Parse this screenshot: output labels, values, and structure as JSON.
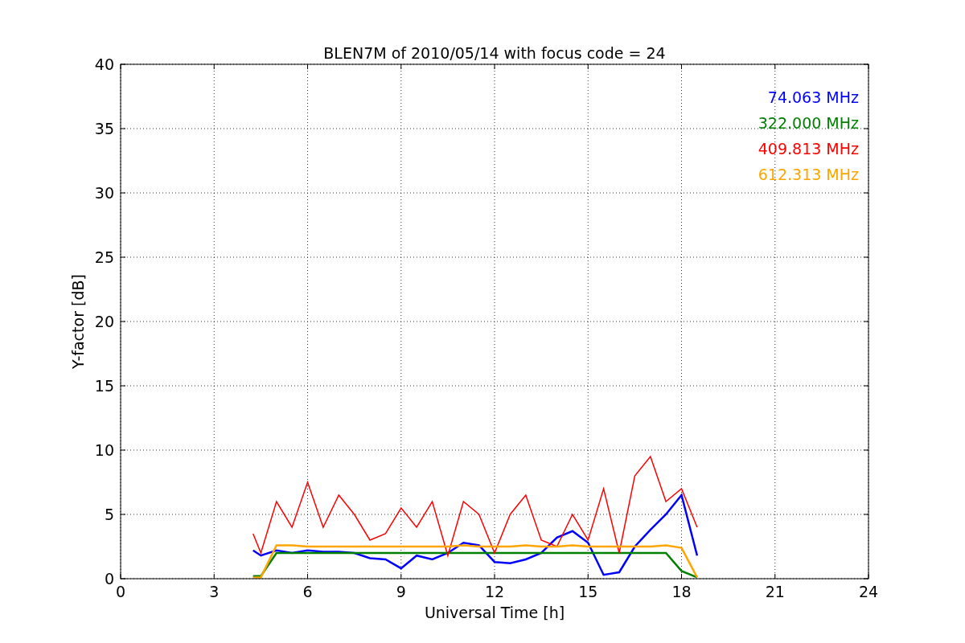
{
  "chart_data": {
    "type": "line",
    "title": "BLEN7M of 2010/05/14 with focus code = 24",
    "xlabel": "Universal Time [h]",
    "ylabel": "Y-factor [dB]",
    "x": [
      4.25,
      4.5,
      5,
      5.5,
      6,
      6.5,
      7,
      7.5,
      8,
      8.5,
      9,
      9.5,
      10,
      10.5,
      11,
      11.5,
      12,
      12.5,
      13,
      13.5,
      14,
      14.5,
      15,
      15.5,
      16,
      16.5,
      17,
      17.5,
      18,
      18.5
    ],
    "series": [
      {
        "name": "74.063 MHz",
        "color": "#0000ff",
        "values": [
          2.2,
          1.8,
          2.2,
          2.0,
          2.2,
          2.1,
          2.1,
          2.0,
          1.6,
          1.5,
          0.8,
          1.8,
          1.5,
          2.0,
          2.8,
          2.6,
          1.3,
          1.2,
          1.5,
          2.0,
          3.2,
          3.7,
          2.8,
          0.3,
          0.5,
          2.5,
          3.8,
          5.0,
          6.5,
          1.8
        ]
      },
      {
        "name": "322.000 MHz",
        "color": "#008000",
        "values": [
          0.2,
          0.2,
          2.0,
          2.0,
          2.0,
          2.0,
          2.0,
          2.0,
          2.0,
          2.0,
          2.0,
          2.0,
          2.0,
          2.0,
          2.0,
          2.0,
          2.0,
          2.0,
          2.0,
          2.0,
          2.0,
          2.0,
          2.0,
          2.0,
          2.0,
          2.0,
          2.0,
          2.0,
          0.6,
          0.1
        ]
      },
      {
        "name": "409.813 MHz",
        "color": "#ff0000",
        "values": [
          3.5,
          2.0,
          6.0,
          4.0,
          7.5,
          4.0,
          6.5,
          5.0,
          3.0,
          3.5,
          5.5,
          4.0,
          6.0,
          1.8,
          6.0,
          5.0,
          2.0,
          5.0,
          6.5,
          3.0,
          2.5,
          5.0,
          3.0,
          7.0,
          2.0,
          8.0,
          9.5,
          6.0,
          7.0,
          4.0
        ]
      },
      {
        "name": "612.313 MHz",
        "color": "#ffa500",
        "values": [
          0.1,
          0.1,
          2.6,
          2.6,
          2.5,
          2.5,
          2.5,
          2.5,
          2.5,
          2.5,
          2.5,
          2.5,
          2.5,
          2.5,
          2.6,
          2.5,
          2.5,
          2.5,
          2.6,
          2.5,
          2.5,
          2.6,
          2.5,
          2.5,
          2.5,
          2.5,
          2.5,
          2.6,
          2.4,
          0.1
        ]
      }
    ],
    "xlim": [
      0,
      24
    ],
    "ylim": [
      0,
      40
    ],
    "xticks": [
      0,
      3,
      6,
      9,
      12,
      15,
      18,
      21,
      24
    ],
    "yticks": [
      0,
      5,
      10,
      15,
      20,
      25,
      30,
      35,
      40
    ],
    "grid": true
  }
}
